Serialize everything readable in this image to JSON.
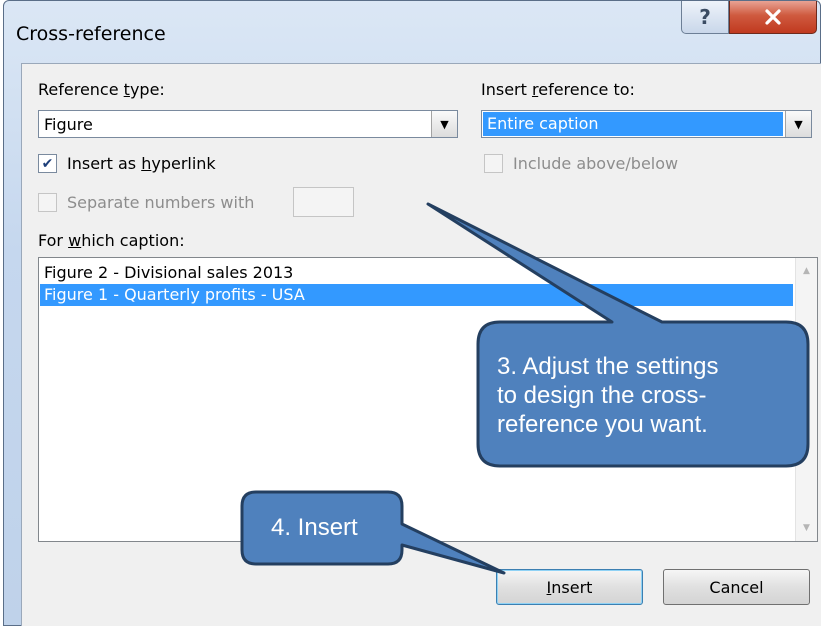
{
  "window": {
    "title": "Cross-reference",
    "help_glyph": "?",
    "close_glyph": "X"
  },
  "reference_type": {
    "label_pre": "Reference ",
    "label_acc": "t",
    "label_post": "ype:",
    "value": "Figure"
  },
  "insert_reference_to": {
    "label_pre": "Insert ",
    "label_acc": "r",
    "label_post": "eference to:",
    "value": "Entire caption"
  },
  "insert_as_hyperlink": {
    "label_pre": "Insert as ",
    "label_acc": "h",
    "label_post": "yperlink",
    "checked": true
  },
  "include_above_below": {
    "label": "Include above/below",
    "checked": false,
    "enabled": false
  },
  "separate_numbers": {
    "label": "Separate numbers with",
    "enabled": false,
    "value": ""
  },
  "for_which_caption": {
    "label_pre": "For ",
    "label_acc": "w",
    "label_post": "hich caption:",
    "items": [
      {
        "text": "Figure 2 - Divisional sales 2013",
        "selected": false
      },
      {
        "text": "Figure 1 - Quarterly profits - USA",
        "selected": true
      }
    ]
  },
  "buttons": {
    "insert_acc": "I",
    "insert_post": "nsert",
    "cancel": "Cancel"
  },
  "annotations": {
    "step3": [
      "3. Adjust the settings",
      "to design the cross-",
      "reference you want."
    ],
    "step4": "4. Insert"
  },
  "colors": {
    "callout_fill": "#4f81bd",
    "callout_stroke": "#243f60",
    "selection": "#3399ff"
  }
}
